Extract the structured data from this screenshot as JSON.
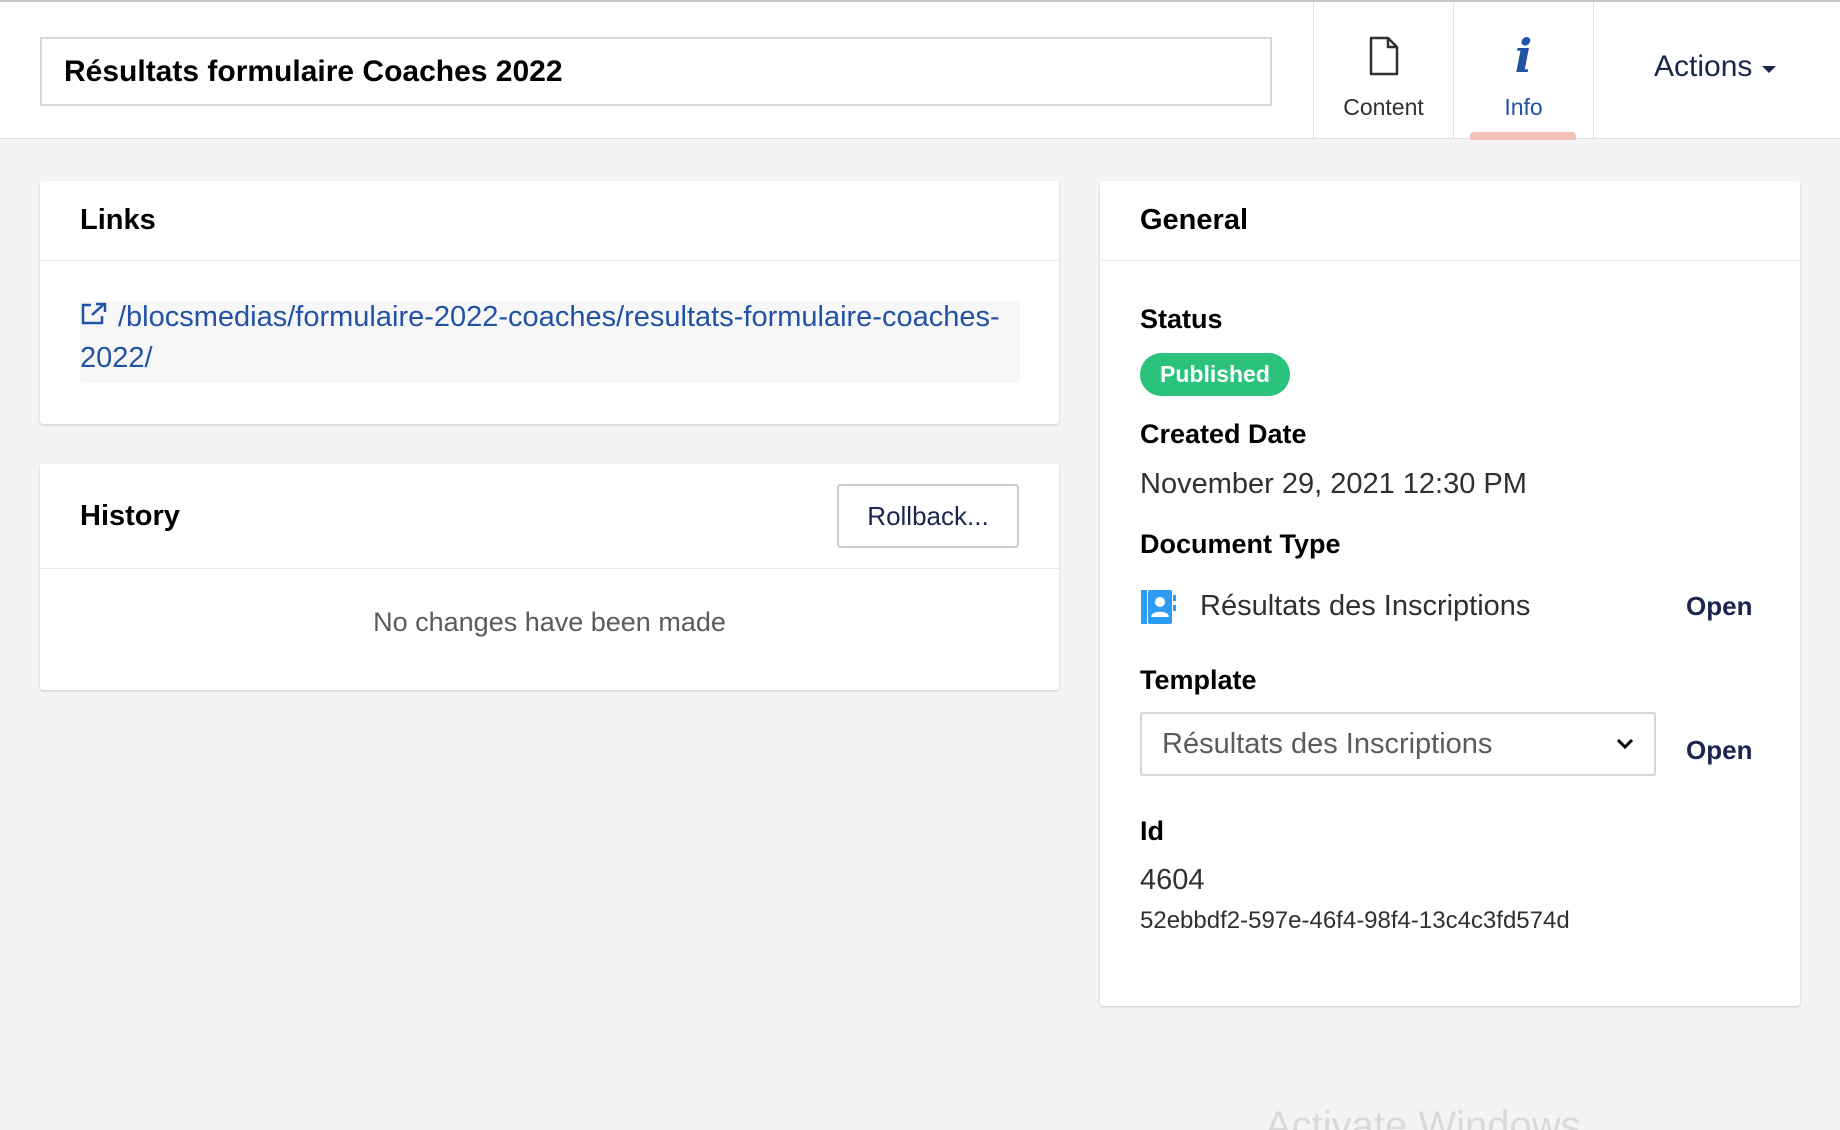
{
  "header": {
    "document_name": "Résultats formulaire Coaches 2022",
    "tabs": [
      {
        "label": "Content",
        "icon": "document-icon",
        "active": false
      },
      {
        "label": "Info",
        "icon": "info-icon",
        "active": true
      }
    ],
    "actions_label": "Actions"
  },
  "links": {
    "title": "Links",
    "url": "/blocsmedias/formulaire-2022-coaches/resultats-formulaire-coaches-2022/"
  },
  "history": {
    "title": "History",
    "rollback_label": "Rollback...",
    "empty_message": "No changes have been made"
  },
  "general": {
    "title": "General",
    "status_label": "Status",
    "status_value": "Published",
    "created_label": "Created Date",
    "created_value": "November 29, 2021 12:30 PM",
    "doctype_label": "Document Type",
    "doctype_value": "Résultats des Inscriptions",
    "doctype_open": "Open",
    "template_label": "Template",
    "template_value": "Résultats des Inscriptions",
    "template_open": "Open",
    "id_label": "Id",
    "id_value": "4604",
    "guid_value": "52ebbdf2-597e-46f4-98f4-13c4c3fd574d"
  },
  "colors": {
    "accent": "#2152a3",
    "status_published": "#2bc37c",
    "active_indicator": "#f5c1bc",
    "background": "#f5f4f5"
  },
  "watermark": "Activate Windows"
}
